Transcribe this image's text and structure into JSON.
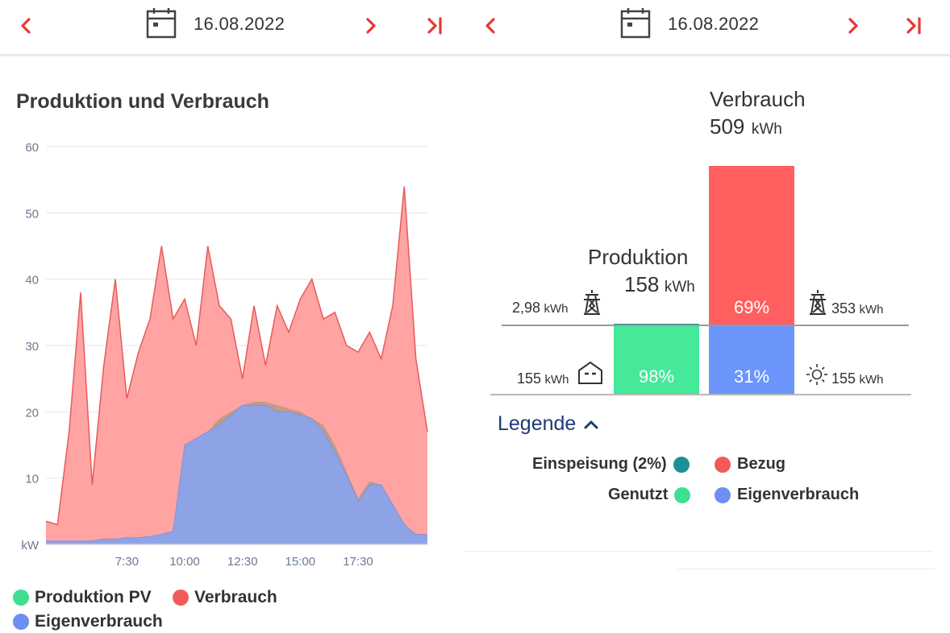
{
  "left": {
    "date": "16.08.2022",
    "title": "Produktion und Verbrauch",
    "legend": [
      {
        "label": "Produktion PV",
        "color": "#3ee08e"
      },
      {
        "label": "Verbrauch",
        "color": "#f25a5a"
      },
      {
        "label": "Eigenverbrauch",
        "color": "#6c8ff0"
      }
    ]
  },
  "right": {
    "date": "16.08.2022",
    "verbrauch_label": "Verbrauch",
    "verbrauch_value": "509",
    "verbrauch_unit": "kWh",
    "produktion_label": "Produktion",
    "produktion_value": "158",
    "produktion_unit": "kWh",
    "einspeisung_kwh": "2,98",
    "bezug_kwh": "353",
    "genutzt_kwh": "155",
    "eigen_kwh": "155",
    "unit": "kWh",
    "pct_genutzt": "98%",
    "pct_bezug": "69%",
    "pct_eigen": "31%",
    "legend_title": "Legende",
    "legend": {
      "einspeisung": "Einspeisung (2%)",
      "bezug": "Bezug",
      "genutzt": "Genutzt",
      "eigenverbrauch": "Eigenverbrauch"
    }
  },
  "colors": {
    "accent": "#e53935",
    "produktion": "#3ee08e",
    "verbrauch": "#f25a5a",
    "eigenverbrauch": "#6c8ff0",
    "einspeisung": "#1e8f95",
    "legend_title": "#1e3a78"
  },
  "chart_data": {
    "type": "area",
    "ylabel": "kW",
    "ylim": [
      0,
      60
    ],
    "yticks": [
      "60",
      "50",
      "40",
      "30",
      "20",
      "10"
    ],
    "xticks": [
      "7:30",
      "10:00",
      "12:30",
      "15:00",
      "17:30"
    ],
    "x": [
      "04:00",
      "04:30",
      "05:00",
      "05:30",
      "06:00",
      "06:30",
      "07:00",
      "07:30",
      "08:00",
      "08:30",
      "09:00",
      "09:30",
      "10:00",
      "10:30",
      "11:00",
      "11:30",
      "12:00",
      "12:30",
      "13:00",
      "13:30",
      "14:00",
      "14:30",
      "15:00",
      "15:30",
      "16:00",
      "16:30",
      "17:00",
      "17:30",
      "18:00",
      "18:30",
      "19:00",
      "19:30",
      "20:00",
      "20:30"
    ],
    "series": [
      {
        "name": "Verbrauch",
        "values": [
          3.5,
          3,
          17,
          38,
          9,
          27,
          40,
          22,
          29,
          34,
          45,
          34,
          37,
          30,
          45,
          36,
          34,
          25,
          36,
          27,
          36,
          32,
          37,
          40,
          34,
          35,
          30,
          29,
          32,
          28,
          36,
          54,
          28,
          17
        ]
      },
      {
        "name": "Produktion PV",
        "values": [
          0.5,
          0.5,
          0.5,
          0.5,
          0.5,
          0.8,
          0.8,
          1,
          1,
          1.2,
          1.5,
          2,
          15,
          16,
          17,
          19,
          20,
          21,
          21.5,
          21.5,
          21,
          20.5,
          20,
          19,
          18,
          15,
          11,
          7,
          9.5,
          9,
          6,
          3,
          1.5,
          1.5
        ]
      },
      {
        "name": "Eigenverbrauch",
        "values": [
          0.5,
          0.5,
          0.5,
          0.5,
          0.5,
          0.8,
          0.8,
          1,
          1,
          1.2,
          1.5,
          2,
          15,
          16,
          17,
          18,
          19.5,
          21,
          21,
          21,
          20,
          20,
          19.5,
          19,
          17,
          14,
          10.5,
          6.5,
          9,
          9,
          6,
          3,
          1.5,
          1.5
        ]
      }
    ]
  }
}
